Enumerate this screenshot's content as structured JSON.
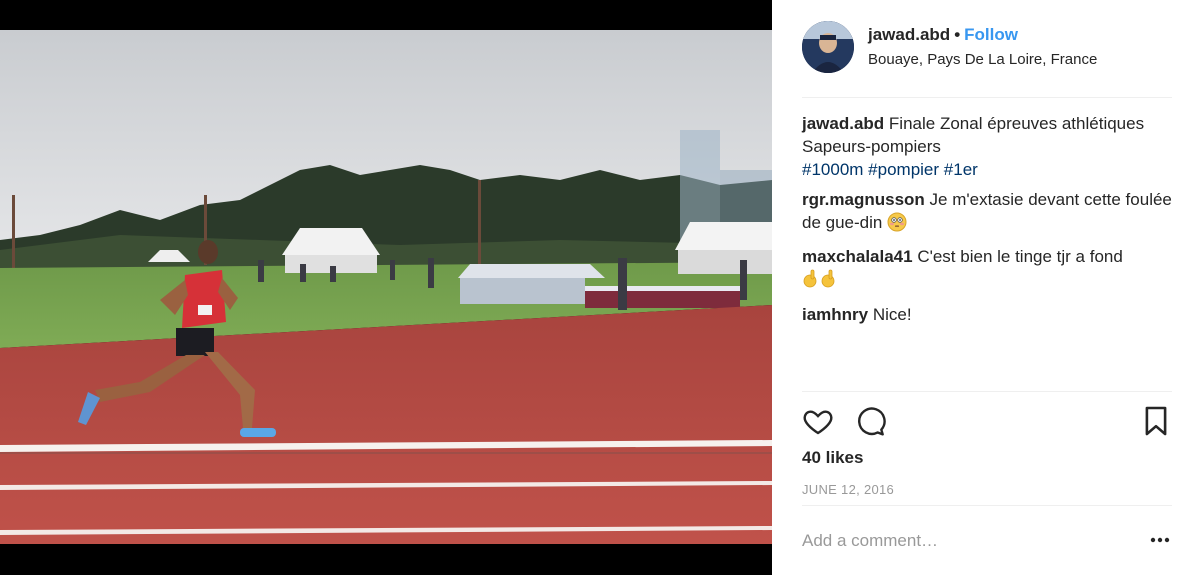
{
  "post": {
    "username": "jawad.abd",
    "follow_label": "Follow",
    "separator": "•",
    "location": "Bouaye, Pays De La Loire, France"
  },
  "comments": [
    {
      "username": "jawad.abd",
      "text": "Finale Zonal épreuves athlétiques Sapeurs-pompiers",
      "hashtags": [
        "#1000m",
        "#pompier",
        "#1er"
      ]
    },
    {
      "username": "rgr.magnusson",
      "text": "Je m'extasie devant cette foulée de gue-din",
      "emoji": "flushed-face-emoji"
    },
    {
      "username": "maxchalala41",
      "text": "C'est bien le tinge tjr a fond",
      "emoji": "ok-hand-emoji"
    },
    {
      "username": "iamhnry",
      "text": "Nice!"
    }
  ],
  "likes": "40 likes",
  "date": "JUNE 12, 2016",
  "add_comment": {
    "placeholder": "Add a comment…"
  },
  "icons": {
    "like": "heart-icon",
    "comment": "comment-bubble-icon",
    "save": "bookmark-icon",
    "more": "more-options-icon"
  },
  "colors": {
    "follow": "#3897f0",
    "hashtag": "#003569",
    "muted": "#999999",
    "track": "#b8443e"
  }
}
